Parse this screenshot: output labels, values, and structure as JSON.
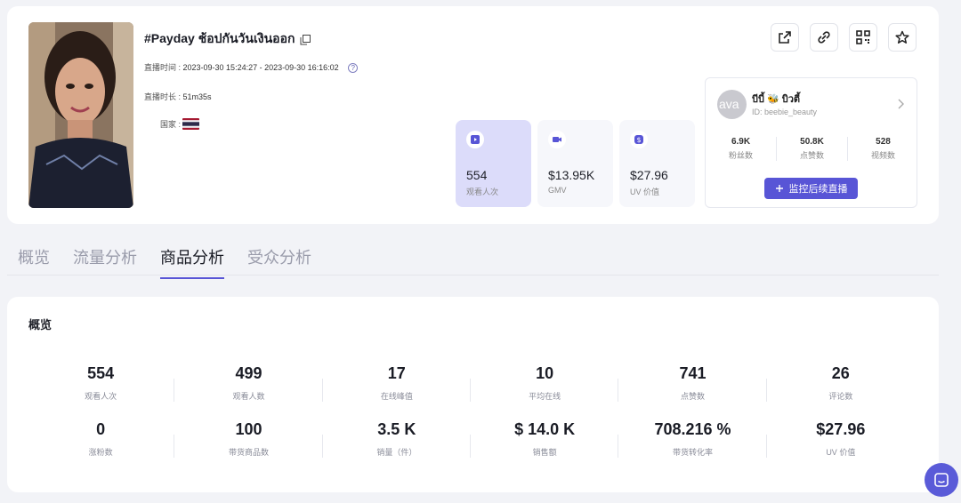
{
  "stream": {
    "title": "#Payday ช้อปกันวันเงินออก",
    "time_label": "直播时间 : ",
    "time_value": "2023-09-30 15:24:27 - 2023-09-30 16:16:02",
    "duration_label": "直播时长 : ",
    "duration_value": "51m35s",
    "country_label": "国家 :",
    "help_glyph": "?"
  },
  "tiles": [
    {
      "value": "554",
      "label": "观看人次",
      "icon": "play-icon"
    },
    {
      "value": "$13.95K",
      "label": "GMV",
      "icon": "video-icon"
    },
    {
      "value": "$27.96",
      "label": "UV 价值",
      "icon": "dollar-icon"
    }
  ],
  "creator": {
    "avatar_alt": "ava",
    "name": "บีบี้ 🐝 บิวตี้",
    "id": "ID: beebie_beauty",
    "stats": [
      {
        "value": "6.9K",
        "label": "粉丝数"
      },
      {
        "value": "50.8K",
        "label": "点赞数"
      },
      {
        "value": "528",
        "label": "视频数"
      }
    ],
    "monitor_label": "监控后续直播"
  },
  "tabs": [
    "概览",
    "流量分析",
    "商品分析",
    "受众分析"
  ],
  "active_tab": "商品分析",
  "overview": {
    "title": "概览",
    "metrics": [
      {
        "value": "554",
        "label": "观看人次"
      },
      {
        "value": "499",
        "label": "观看人数"
      },
      {
        "value": "17",
        "label": "在线峰值"
      },
      {
        "value": "10",
        "label": "平均在线"
      },
      {
        "value": "741",
        "label": "点赞数"
      },
      {
        "value": "26",
        "label": "评论数"
      },
      {
        "value": "0",
        "label": "涨粉数"
      },
      {
        "value": "100",
        "label": "带货商品数"
      },
      {
        "value": "3.5 K",
        "label": "销量（件）"
      },
      {
        "value": "$ 14.0 K",
        "label": "销售额"
      },
      {
        "value": "708.216 %",
        "label": "带货转化率"
      },
      {
        "value": "$27.96",
        "label": "UV 价值"
      }
    ]
  },
  "colors": {
    "accent": "#5855d6",
    "active_tile": "#dcdcfa"
  }
}
